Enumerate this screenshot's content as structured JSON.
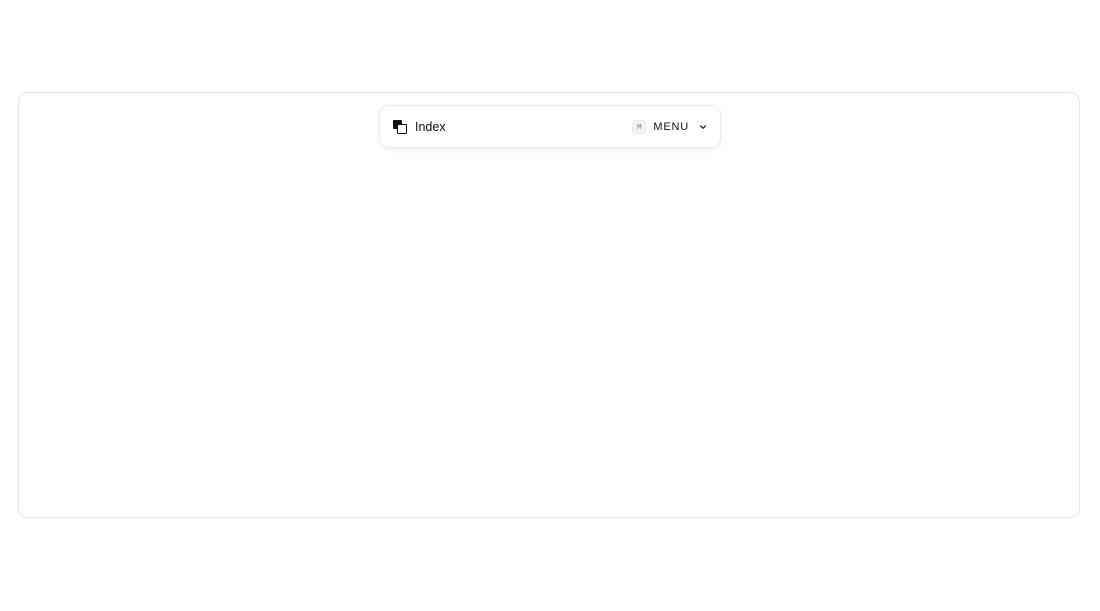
{
  "navbar": {
    "brand_label": "Index",
    "menu_shortcut": "M",
    "menu_label": "MENU"
  },
  "icons": {
    "logo": "overlapping-squares-icon",
    "menu_chevron": "chevron-down-icon"
  },
  "colors": {
    "text": "#111111",
    "border": "#e6e6e6",
    "background": "#ffffff"
  }
}
